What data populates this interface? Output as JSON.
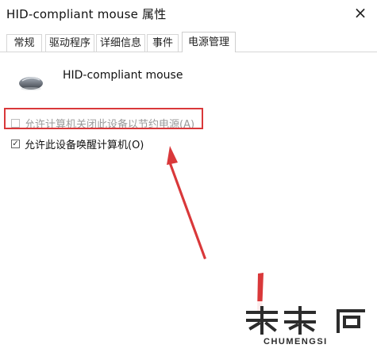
{
  "window": {
    "title": "HID-compliant mouse 属性",
    "close_label": "×"
  },
  "tabs": [
    {
      "label": "常规"
    },
    {
      "label": "驱动程序"
    },
    {
      "label": "详细信息"
    },
    {
      "label": "事件"
    },
    {
      "label": "电源管理"
    }
  ],
  "device": {
    "name": "HID-compliant mouse",
    "icon": "mouse-icon"
  },
  "options": [
    {
      "label": "允许计算机关闭此设备以节约电源(A)",
      "checked": false,
      "enabled": false
    },
    {
      "label": "允许此设备唤醒计算机(O)",
      "checked": true,
      "enabled": true
    }
  ],
  "annotation": {
    "highlight_color": "#d9383a",
    "arrow_color": "#d9383a"
  },
  "watermark": {
    "text": "CHUMENGSI"
  }
}
